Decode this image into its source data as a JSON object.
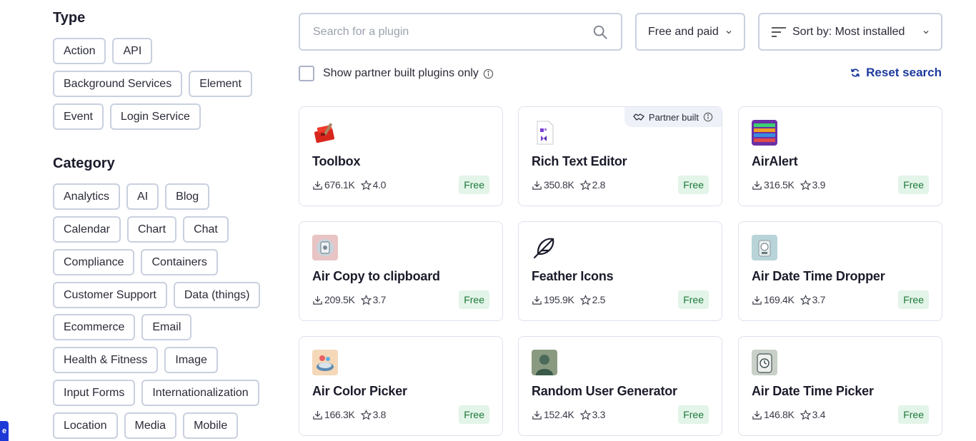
{
  "sidebar": {
    "type_title": "Type",
    "type_chips": [
      "Action",
      "API",
      "Background Services",
      "Element",
      "Event",
      "Login Service"
    ],
    "category_title": "Category",
    "category_chips": [
      "Analytics",
      "AI",
      "Blog",
      "Calendar",
      "Chart",
      "Chat",
      "Compliance",
      "Containers",
      "Customer Support",
      "Data (things)",
      "Ecommerce",
      "Email",
      "Health & Fitness",
      "Image",
      "Input Forms",
      "Internationalization",
      "Location",
      "Media",
      "Mobile"
    ],
    "edge_tab_label": "e"
  },
  "search": {
    "placeholder": "Search for a plugin",
    "value": ""
  },
  "filters": {
    "price_selected": "Free and paid",
    "sort_selected": "Sort by: Most installed"
  },
  "partner_filter": {
    "label": "Show partner built plugins only",
    "checked": false
  },
  "reset_label": "Reset search",
  "colors": {
    "accent": "#1e3a9e",
    "free_badge_bg": "#e3f4e8",
    "free_badge_text": "#1d7a3b",
    "border": "#c9d0df"
  },
  "plugins": [
    {
      "name": "Toolbox",
      "installs": "676.1K",
      "rating": "4.0",
      "price": "Free",
      "partner_built": false,
      "icon": "toolbox-icon"
    },
    {
      "name": "Rich Text Editor",
      "installs": "350.8K",
      "rating": "2.8",
      "price": "Free",
      "partner_built": true,
      "partner_label": "Partner built",
      "icon": "rich-text-editor-icon"
    },
    {
      "name": "AirAlert",
      "installs": "316.5K",
      "rating": "3.9",
      "price": "Free",
      "partner_built": false,
      "icon": "airalert-icon"
    },
    {
      "name": "Air Copy to clipboard",
      "installs": "209.5K",
      "rating": "3.7",
      "price": "Free",
      "partner_built": false,
      "icon": "clipboard-icon"
    },
    {
      "name": "Feather Icons",
      "installs": "195.9K",
      "rating": "2.5",
      "price": "Free",
      "partner_built": false,
      "icon": "feather-icon"
    },
    {
      "name": "Air Date Time Dropper",
      "installs": "169.4K",
      "rating": "3.7",
      "price": "Free",
      "partner_built": false,
      "icon": "date-time-dropper-icon"
    },
    {
      "name": "Air Color Picker",
      "installs": "166.3K",
      "rating": "3.8",
      "price": "Free",
      "partner_built": false,
      "icon": "color-picker-icon"
    },
    {
      "name": "Random User Generator",
      "installs": "152.4K",
      "rating": "3.3",
      "price": "Free",
      "partner_built": false,
      "icon": "user-generator-icon"
    },
    {
      "name": "Air Date Time Picker",
      "installs": "146.8K",
      "rating": "3.4",
      "price": "Free",
      "partner_built": false,
      "icon": "date-time-picker-icon"
    }
  ]
}
